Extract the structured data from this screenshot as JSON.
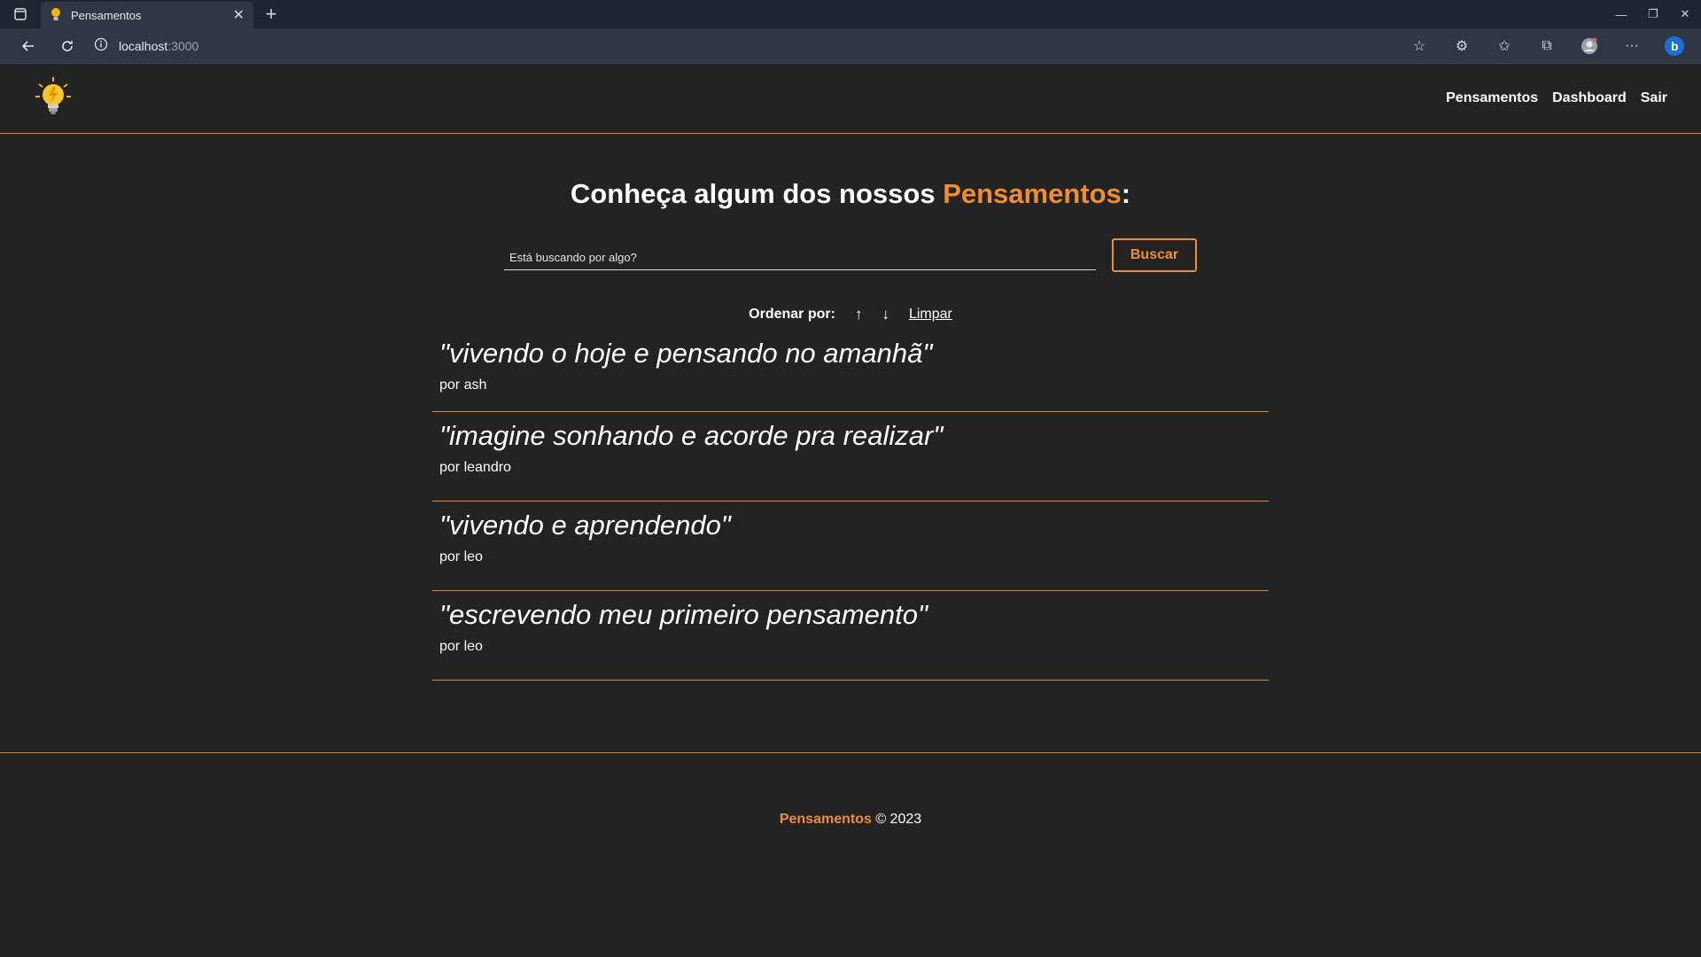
{
  "browser": {
    "tab_title": "Pensamentos",
    "url_host": "localhost",
    "url_port": ":3000"
  },
  "header": {
    "nav": [
      "Pensamentos",
      "Dashboard",
      "Sair"
    ]
  },
  "main": {
    "title_prefix": "Conheça algum dos nossos ",
    "title_accent": "Pensamentos",
    "title_suffix": ":",
    "search_placeholder": "Está buscando por algo?",
    "search_button": "Buscar",
    "order_label": "Ordenar por:",
    "order_asc": "↑",
    "order_desc": "↓",
    "order_clear": "Limpar"
  },
  "thoughts": [
    {
      "quote": "\"vivendo o hoje e pensando no amanhã\"",
      "author": "por ash"
    },
    {
      "quote": "\"imagine sonhando e acorde pra realizar\"",
      "author": "por leandro"
    },
    {
      "quote": "\"vivendo e aprendendo\"",
      "author": "por leo"
    },
    {
      "quote": "\"escrevendo meu primeiro pensamento\"",
      "author": "por leo"
    }
  ],
  "footer": {
    "brand": "Pensamentos",
    "copyright": " © 2023"
  },
  "colors": {
    "accent": "#ef8e2f",
    "background": "#232323"
  }
}
